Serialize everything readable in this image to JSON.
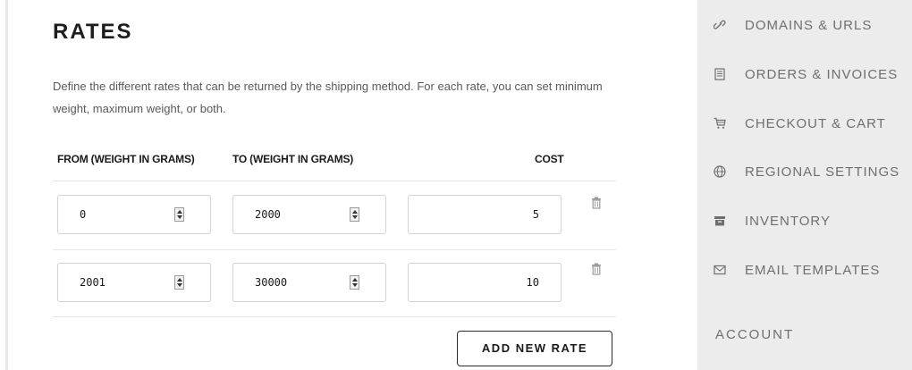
{
  "rates": {
    "title": "RATES",
    "description": "Define the different rates that can be returned by the shipping method. For each rate, you can set minimum weight, maximum weight, or both.",
    "columns": {
      "from": "FROM (WEIGHT IN GRAMS)",
      "to": "TO (WEIGHT IN GRAMS)",
      "cost": "COST"
    },
    "rows": [
      {
        "from": "0",
        "to": "2000",
        "cost": "5"
      },
      {
        "from": "2001",
        "to": "30000",
        "cost": "10"
      }
    ],
    "add_button_label": "ADD NEW RATE"
  },
  "sidebar": {
    "items": [
      {
        "label": "DOMAINS & URLS",
        "icon": "link-icon"
      },
      {
        "label": "ORDERS & INVOICES",
        "icon": "invoice-icon"
      },
      {
        "label": "CHECKOUT & CART",
        "icon": "cart-icon"
      },
      {
        "label": "REGIONAL SETTINGS",
        "icon": "globe-icon"
      },
      {
        "label": "INVENTORY",
        "icon": "box-icon"
      },
      {
        "label": "EMAIL TEMPLATES",
        "icon": "envelope-icon"
      }
    ],
    "section_heading": "ACCOUNT"
  }
}
